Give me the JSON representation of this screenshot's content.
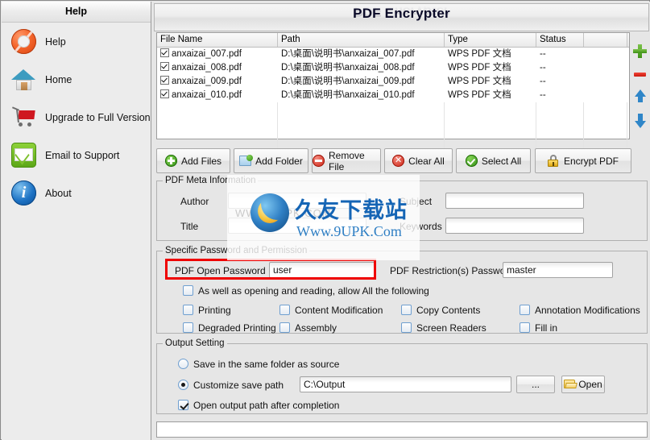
{
  "window": {
    "title": "PDF Encrypter"
  },
  "sidebar": {
    "header": "Help",
    "items": [
      {
        "label": "Help",
        "icon": "life-ring-icon"
      },
      {
        "label": "Home",
        "icon": "house-icon"
      },
      {
        "label": "Upgrade to Full Version",
        "icon": "shopping-cart-icon"
      },
      {
        "label": "Email to Support",
        "icon": "envelope-icon"
      },
      {
        "label": "About",
        "icon": "info-icon"
      }
    ]
  },
  "file_table": {
    "columns": [
      "File Name",
      "Path",
      "Type",
      "Status",
      ""
    ],
    "rows": [
      {
        "checked": true,
        "name": "anxaizai_007.pdf",
        "path": "D:\\桌面\\说明书\\anxaizai_007.pdf",
        "type": "WPS PDF 文档",
        "status": "--"
      },
      {
        "checked": true,
        "name": "anxaizai_008.pdf",
        "path": "D:\\桌面\\说明书\\anxaizai_008.pdf",
        "type": "WPS PDF 文档",
        "status": "--"
      },
      {
        "checked": true,
        "name": "anxaizai_009.pdf",
        "path": "D:\\桌面\\说明书\\anxaizai_009.pdf",
        "type": "WPS PDF 文档",
        "status": "--"
      },
      {
        "checked": true,
        "name": "anxaizai_010.pdf",
        "path": "D:\\桌面\\说明书\\anxaizai_010.pdf",
        "type": "WPS PDF 文档",
        "status": "--"
      }
    ],
    "empty_row_count": 4
  },
  "list_tools": [
    {
      "name": "add-row-icon",
      "glyph": "plus",
      "color": "#3f9116"
    },
    {
      "name": "remove-row-icon",
      "glyph": "minus",
      "color": "#c9180c"
    },
    {
      "name": "move-up-icon",
      "glyph": "arrow-up",
      "color": "#2f86c8"
    },
    {
      "name": "move-down-icon",
      "glyph": "arrow-down",
      "color": "#2f86c8"
    }
  ],
  "toolbar": {
    "add_files": "Add Files",
    "add_folder": "Add Folder",
    "remove_file": "Remove File",
    "clear_all": "Clear All",
    "clear_all_glyph": "✕",
    "select_all": "Select All",
    "encrypt_pdf": "Encrypt PDF"
  },
  "meta": {
    "legend": "PDF Meta Information",
    "author_label": "Author",
    "author_value": "",
    "title_label": "Title",
    "title_value": "",
    "subject_label": "Subject",
    "subject_value": "",
    "keywords_label": "Keywords",
    "keywords_value": ""
  },
  "password": {
    "legend": "Specific Password and Permission",
    "open_label": "PDF Open Password",
    "open_value": "user",
    "restriction_label": "PDF Restriction(s) Password",
    "restriction_value": "master",
    "allow_all_label": "As well as opening and reading, allow All the following",
    "allow_all_checked": false,
    "permissions": [
      {
        "label": "Printing",
        "checked": false
      },
      {
        "label": "Content Modification",
        "checked": false
      },
      {
        "label": "Copy Contents",
        "checked": false
      },
      {
        "label": "Annotation Modifications",
        "checked": false
      },
      {
        "label": "Degraded Printing",
        "checked": false
      },
      {
        "label": "Assembly",
        "checked": false
      },
      {
        "label": "Screen Readers",
        "checked": false
      },
      {
        "label": "Fill in",
        "checked": false
      }
    ]
  },
  "output": {
    "legend": "Output Setting",
    "same_folder_label": "Save in the same folder as source",
    "same_folder_selected": false,
    "customize_label": "Customize save path",
    "customize_selected": true,
    "path_value": "C:\\Output",
    "browse_label": "...",
    "open_label": "Open",
    "open_after_label": "Open output path after completion",
    "open_after_checked": true
  },
  "statusbar": {
    "text": ""
  },
  "watermark": {
    "site_cn": "久友下载站",
    "site_url": "Www.9UPK.Com",
    "faint_url": "WWW.9UPK.COM"
  },
  "colors": {
    "highlight_box": "#ef0000",
    "accent_blue": "#2f7fc4",
    "accent_green": "#3f9116",
    "accent_red": "#c9180c"
  }
}
